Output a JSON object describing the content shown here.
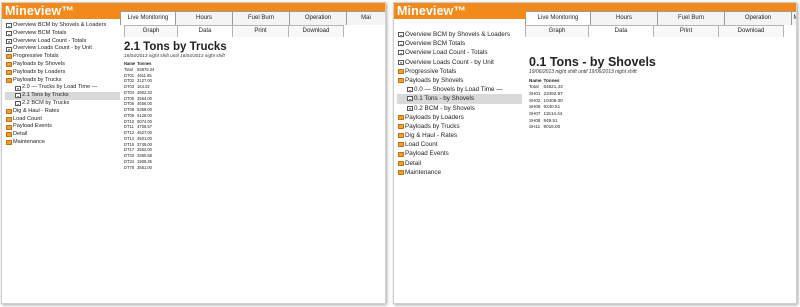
{
  "app": {
    "logo": "Mineview™"
  },
  "left": {
    "tabs": [
      "Live Monitoring",
      "Hours",
      "Fuel Burn",
      "Operation",
      "Mai"
    ],
    "active_tab": "Live Monitoring",
    "subtabs": [
      "Graph",
      "Data",
      "Print",
      "Download"
    ],
    "active_subtab": "Data",
    "sidebar": [
      {
        "label": "Overview BCM by Shovels & Loaders",
        "icon": "document-icon",
        "indent": false,
        "selected": false
      },
      {
        "label": "Overview BCM Totals",
        "icon": "document-icon",
        "indent": false,
        "selected": false
      },
      {
        "label": "Overview Load Count - Totals",
        "icon": "document-icon",
        "indent": false,
        "selected": false
      },
      {
        "label": "Overview Loads Count - by Unit",
        "icon": "document-icon",
        "indent": false,
        "selected": false
      },
      {
        "label": "Progressive Totals",
        "icon": "folder-icon",
        "indent": false,
        "selected": false
      },
      {
        "label": "Payloads by Shovels",
        "icon": "folder-icon",
        "indent": false,
        "selected": false
      },
      {
        "label": "Payloads by Loaders",
        "icon": "folder-icon",
        "indent": false,
        "selected": false
      },
      {
        "label": "Payloads by Trucks",
        "icon": "folder-icon",
        "indent": false,
        "selected": false
      },
      {
        "label": "2.0 — Trucks by Load Time —",
        "icon": "document-icon",
        "indent": true,
        "selected": false
      },
      {
        "label": "2.1 Tons by Trucks",
        "icon": "document-icon",
        "indent": true,
        "selected": true
      },
      {
        "label": "2.2 BCM by Trucks",
        "icon": "document-icon",
        "indent": true,
        "selected": false
      },
      {
        "label": "Dig & Haul - Rates",
        "icon": "folder-icon",
        "indent": false,
        "selected": false
      },
      {
        "label": "Load Count",
        "icon": "folder-icon",
        "indent": false,
        "selected": false
      },
      {
        "label": "Payload Events",
        "icon": "folder-icon",
        "indent": false,
        "selected": false
      },
      {
        "label": "Detail",
        "icon": "folder-icon",
        "indent": false,
        "selected": false
      },
      {
        "label": "Maintenance",
        "icon": "folder-icon",
        "indent": false,
        "selected": false
      }
    ],
    "report": {
      "title": "2.1 Tons by Trucks",
      "subtitle": "16/04/2013 night shift until 16/04/2013 night shift",
      "headers": [
        "Name",
        "Tonnes"
      ],
      "rows": [
        [
          "Total",
          "83879.34"
        ],
        [
          "DT01",
          "4911.65"
        ],
        [
          "DT02",
          "2127.00"
        ],
        [
          "DT03",
          "164.02"
        ],
        [
          "DT04",
          "4902.20"
        ],
        [
          "DT05",
          "2564.00"
        ],
        [
          "DT06",
          "4656.00"
        ],
        [
          "DT08",
          "5359.00"
        ],
        [
          "DT09",
          "5128.00"
        ],
        [
          "DT10",
          "5074.00"
        ],
        [
          "DT11",
          "4708.57"
        ],
        [
          "DT12",
          "4527.00"
        ],
        [
          "DT14",
          "4501.00"
        ],
        [
          "DT15",
          "3749.00"
        ],
        [
          "DT17",
          "2552.00"
        ],
        [
          "DT33",
          "3360.58"
        ],
        [
          "DT34",
          "1909.36"
        ],
        [
          "DT78",
          "3561.00"
        ]
      ]
    }
  },
  "right": {
    "tabs": [
      "Live Monitoring",
      "Hours",
      "Fuel Burn",
      "Operation",
      "M"
    ],
    "active_tab": "Live Monitoring",
    "subtabs": [
      "Graph",
      "Data",
      "Print",
      "Download"
    ],
    "active_subtab": "Data",
    "sidebar": [
      {
        "label": "Overview BCM by Shovels & Loaders",
        "icon": "document-icon",
        "indent": false,
        "selected": false
      },
      {
        "label": "Overview BCM Totals",
        "icon": "document-icon",
        "indent": false,
        "selected": false
      },
      {
        "label": "Overview Load Count - Totals",
        "icon": "document-icon",
        "indent": false,
        "selected": false
      },
      {
        "label": "Overview Loads Count - by Unit",
        "icon": "document-icon",
        "indent": false,
        "selected": false
      },
      {
        "label": "Progressive Totals",
        "icon": "folder-icon",
        "indent": false,
        "selected": false
      },
      {
        "label": "Payloads by Shovels",
        "icon": "folder-icon",
        "indent": false,
        "selected": false
      },
      {
        "label": "0.0 — Shovels by Load Time —",
        "icon": "document-icon",
        "indent": true,
        "selected": false
      },
      {
        "label": "0.1 Tons - by Shovels",
        "icon": "document-icon",
        "indent": true,
        "selected": true
      },
      {
        "label": "0.2 BCM - by Shovels",
        "icon": "document-icon",
        "indent": true,
        "selected": false
      },
      {
        "label": "Payloads by Loaders",
        "icon": "folder-icon",
        "indent": false,
        "selected": false
      },
      {
        "label": "Payloads by Trucks",
        "icon": "folder-icon",
        "indent": false,
        "selected": false
      },
      {
        "label": "Dig & Haul - Rates",
        "icon": "folder-icon",
        "indent": false,
        "selected": false
      },
      {
        "label": "Load Count",
        "icon": "folder-icon",
        "indent": false,
        "selected": false
      },
      {
        "label": "Payload Events",
        "icon": "folder-icon",
        "indent": false,
        "selected": false
      },
      {
        "label": "Detail",
        "icon": "folder-icon",
        "indent": false,
        "selected": false
      },
      {
        "label": "Maintenance",
        "icon": "folder-icon",
        "indent": false,
        "selected": false
      }
    ],
    "report": {
      "title": "0.1 Tons - by Shovels",
      "subtitle": "19/06/2013 night shift until 19/06/2013 night shift",
      "headers": [
        "Name",
        "Tonnes"
      ],
      "rows": [
        [
          "Total",
          "64621.43"
        ],
        [
          "SH01",
          "23492.97"
        ],
        [
          "SH02",
          "10408.00"
        ],
        [
          "SH06",
          "9240.51"
        ],
        [
          "SH07",
          "11514.44"
        ],
        [
          "SH08",
          "949.51"
        ],
        [
          "SH11",
          "9016.00"
        ]
      ]
    }
  },
  "colors": {
    "brand_orange": "#f28a1b",
    "selected_row": "#d9d9d9"
  }
}
